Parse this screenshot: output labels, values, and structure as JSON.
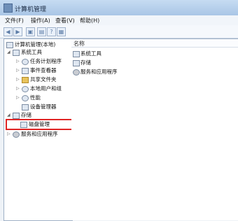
{
  "window": {
    "title": "计算机管理"
  },
  "menu": {
    "items": [
      "文件(F)",
      "操作(A)",
      "查看(V)",
      "帮助(H)"
    ]
  },
  "tree": {
    "root": "计算机管理(本地)",
    "system_tools": "系统工具",
    "task_scheduler": "任务计划程序",
    "event_viewer": "事件查看器",
    "shared_folders": "共享文件夹",
    "local_users_groups": "本地用户和组",
    "performance": "性能",
    "device_manager": "设备管理器",
    "storage": "存储",
    "disk_management": "磁盘管理",
    "services_apps": "服务和应用程序"
  },
  "list": {
    "header": "名称",
    "items": [
      "系统工具",
      "存储",
      "服务和应用程序"
    ]
  },
  "colors": {
    "highlight_box": "#e02525"
  }
}
